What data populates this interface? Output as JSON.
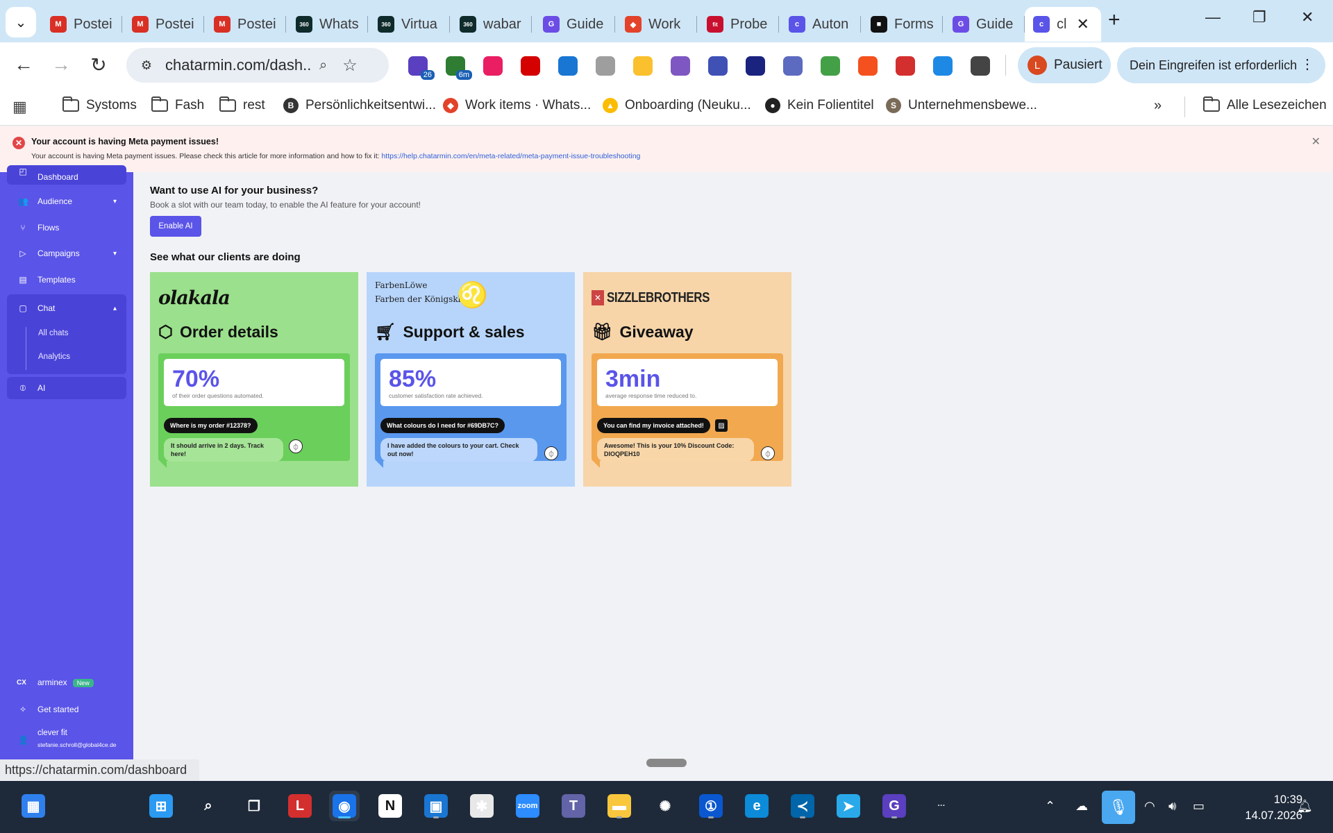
{
  "browser": {
    "tabs": [
      {
        "label": "Postei",
        "icon": "gmail-icon",
        "color": "#d93025",
        "glyph": "M"
      },
      {
        "label": "Postei",
        "icon": "gmail-icon",
        "color": "#d93025",
        "glyph": "M"
      },
      {
        "label": "Postei",
        "icon": "gmail-icon",
        "color": "#d93025",
        "glyph": "M"
      },
      {
        "label": "Whats",
        "icon": "360dialog-icon",
        "color": "#0f2b2b",
        "glyph": "360"
      },
      {
        "label": "Virtua",
        "icon": "360dialog-icon",
        "color": "#0f2b2b",
        "glyph": "360"
      },
      {
        "label": "wabar",
        "icon": "360dialog-icon",
        "color": "#0f2b2b",
        "glyph": "360"
      },
      {
        "label": "Guide",
        "icon": "g-brand-icon",
        "color": "#6b4de6",
        "glyph": "G"
      },
      {
        "label": "Work",
        "icon": "gitlab-icon",
        "color": "#e2432a",
        "glyph": "◆"
      },
      {
        "label": "Probe",
        "icon": "fit-icon",
        "color": "#c8102e",
        "glyph": "fit"
      },
      {
        "label": "Auton",
        "icon": "chatarmin-icon",
        "color": "#5a54e8",
        "glyph": "c"
      },
      {
        "label": "Forms",
        "icon": "forms-icon",
        "color": "#111111",
        "glyph": "■"
      },
      {
        "label": "Guide",
        "icon": "g-brand-icon",
        "color": "#6b4de6",
        "glyph": "G"
      },
      {
        "label": "cl",
        "icon": "chatarmin-icon",
        "color": "#5a54e8",
        "glyph": "c",
        "active": true
      }
    ],
    "url": "chatarmin.com/dash...",
    "profile": {
      "initial": "L",
      "label": "Pausiert"
    },
    "action_label": "Dein Eingreifen ist erforderlich",
    "extensions": [
      {
        "name": "home-extension-icon",
        "color": "#5a3fc0",
        "badge": "26"
      },
      {
        "name": "calendar-extension-icon",
        "color": "#2e7d32",
        "badge": "6m"
      },
      {
        "name": "figma-extension-icon",
        "color": "#e91e63"
      },
      {
        "name": "eyedropper-extension-icon",
        "color": "#d50000"
      },
      {
        "name": "c-extension-icon",
        "color": "#1976d2"
      },
      {
        "name": "camera-extension-icon",
        "color": "#9e9e9e"
      },
      {
        "name": "face-extension-icon",
        "color": "#fbc02d"
      },
      {
        "name": "ring-extension-icon",
        "color": "#7e57c2"
      },
      {
        "name": "cloud-lock-extension-icon",
        "color": "#3f51b5"
      },
      {
        "name": "password-extension-icon",
        "color": "#1a237e"
      },
      {
        "name": "clock-extension-icon",
        "color": "#5c6bc0"
      },
      {
        "name": "frog-extension-icon",
        "color": "#43a047"
      },
      {
        "name": "fox-extension-icon",
        "color": "#f4511e"
      },
      {
        "name": "grammarly-extension-icon",
        "color": "#d32f2f"
      },
      {
        "name": "snowflake-extension-icon",
        "color": "#1e88e5"
      },
      {
        "name": "puzzle-extension-icon",
        "color": "#444444"
      }
    ]
  },
  "bookmarks": [
    {
      "label": "Systoms",
      "type": "folder"
    },
    {
      "label": "Fash",
      "type": "folder"
    },
    {
      "label": "rest",
      "type": "folder"
    },
    {
      "label": "Persönlichkeitsentwi...",
      "type": "site",
      "icon": "b-icon",
      "color": "#333333",
      "glyph": "B"
    },
    {
      "label": "Work items · Whats...",
      "type": "site",
      "icon": "gitlab-icon",
      "color": "#e2432a",
      "glyph": "◆"
    },
    {
      "label": "Onboarding (Neuku...",
      "type": "site",
      "icon": "drive-icon",
      "color": "#fbbc04",
      "glyph": "▲"
    },
    {
      "label": "Kein Folientitel",
      "type": "site",
      "icon": "globe-icon",
      "color": "#222222",
      "glyph": "●"
    },
    {
      "label": "Unternehmensbewe...",
      "type": "site",
      "icon": "s-icon",
      "color": "#7a6a58",
      "glyph": "S"
    }
  ],
  "bookmarks_all": "Alle Lesezeichen",
  "alert": {
    "title": "Your account is having Meta payment issues!",
    "text": "Your account is having Meta payment issues. Please check this article for more information and how to fix it: ",
    "link": "https://help.chatarmin.com/en/meta-related/meta-payment-issue-troubleshooting"
  },
  "sidebar": {
    "dashboard": "Dashboard",
    "audience": "Audience",
    "flows": "Flows",
    "campaigns": "Campaigns",
    "templates": "Templates",
    "chat": "Chat",
    "all_chats": "All chats",
    "analytics": "Analytics",
    "ai": "AI",
    "arminex": "arminex",
    "new_badge": "New",
    "get_started": "Get started",
    "user_name": "clever fit",
    "user_email": "stefanie.schroll@global4ce.de"
  },
  "main": {
    "ai_heading": "Want to use AI for your business?",
    "ai_sub": "Book a slot with our team today, to enable the AI feature for your account!",
    "enable_ai": "Enable AI",
    "clients_heading": "See what our clients are doing",
    "cards": [
      {
        "logo": "olakala",
        "title": "Order details",
        "icon": "box-icon",
        "bg": "#9be08c",
        "panel": "#6bcf5b",
        "stat": "70%",
        "stat_desc": "of their order questions automated.",
        "question": "Where is my order #12378?",
        "answer": "It should arrive in 2 days. Track here!",
        "answer_bg": "#a6e597"
      },
      {
        "logo_top": "FarbenLöwe",
        "logo": "Farben der Königsklasse",
        "title": "Support & sales",
        "icon": "cart-icon",
        "bg": "#b7d5fb",
        "panel": "#5a98ee",
        "stat": "85%",
        "stat_desc": "customer satisfaction rate achieved.",
        "question": "What colours do I need for #69DB7C?",
        "answer": "I have added the colours to your cart. Check out now!",
        "answer_bg": "#bcd7fb"
      },
      {
        "logo": "SIZZLEBROTHERS",
        "title": "Giveaway",
        "icon": "gift-icon",
        "bg": "#f7d5a9",
        "panel": "#f1a84f",
        "stat": "3min",
        "stat_desc": "average response time reduced to.",
        "question": "You can find my invoice attached!",
        "answer": "Awesome! This is your 10% Discount Code: DIOQPEH10",
        "answer_bg": "#f8d6a8"
      }
    ]
  },
  "status_url": "https://chatarmin.com/dashboard",
  "taskbar": {
    "time": "10:39",
    "date": "14.07.2026",
    "apps": [
      {
        "name": "widgets-icon",
        "color": "#2f80ed",
        "glyph": "▦"
      },
      {
        "name": "start-icon",
        "color": "#2b9af3",
        "glyph": "⊞"
      },
      {
        "name": "search-icon",
        "color": "transparent",
        "glyph": "⌕"
      },
      {
        "name": "task-view-icon",
        "color": "transparent",
        "glyph": "❐"
      },
      {
        "name": "lastpass-icon",
        "color": "#d32f2f",
        "glyph": "L"
      },
      {
        "name": "chrome-icon",
        "color": "#1a73e8",
        "glyph": "◉",
        "active": true
      },
      {
        "name": "notion-icon",
        "color": "#ffffff",
        "glyph": "N"
      },
      {
        "name": "files-blue-icon",
        "color": "#1976d2",
        "glyph": "▣"
      },
      {
        "name": "slack-icon",
        "color": "#e8e8e8",
        "glyph": "✱"
      },
      {
        "name": "zoom-icon",
        "color": "#2d8cff",
        "glyph": "zoom"
      },
      {
        "name": "teams-icon",
        "color": "#6264a7",
        "glyph": "T"
      },
      {
        "name": "explorer-icon",
        "color": "#f9c73e",
        "glyph": "▬"
      },
      {
        "name": "chatgpt-icon",
        "color": "transparent",
        "glyph": "✺"
      },
      {
        "name": "onepassword-icon",
        "color": "#0a57d0",
        "glyph": "①"
      },
      {
        "name": "edge-icon",
        "color": "#0c8bd8",
        "glyph": "e"
      },
      {
        "name": "vscode-icon",
        "color": "#0065a9",
        "glyph": "≺"
      },
      {
        "name": "telegram-icon",
        "color": "#29a9ea",
        "glyph": "➤"
      },
      {
        "name": "gpt-ext-icon",
        "color": "#5a3fc0",
        "glyph": "G"
      },
      {
        "name": "more-apps-icon",
        "color": "transparent",
        "glyph": "···"
      }
    ]
  }
}
